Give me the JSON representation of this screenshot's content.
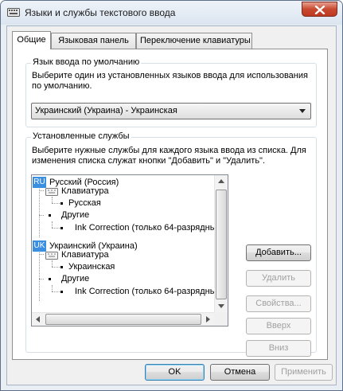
{
  "window": {
    "title": "Языки и службы текстового ввода",
    "close_icon": "close-icon"
  },
  "tabs": [
    {
      "label": "Общие",
      "active": true
    },
    {
      "label": "Языковая панель",
      "active": false
    },
    {
      "label": "Переключение клавиатуры",
      "active": false
    }
  ],
  "default_language": {
    "legend": "Язык ввода по умолчанию",
    "description": [
      "Выберите один из установленных языков ввода для использования",
      "по умолчанию."
    ],
    "selected": "Украинский (Украина) - Украинская"
  },
  "installed_services": {
    "legend": "Установленные службы",
    "description": [
      "Выберите нужные службы для каждого языка ввода из списка. Для",
      "изменения списка служат кнопки \"Добавить\" и \"Удалить\"."
    ],
    "tree": [
      {
        "badge": "RU",
        "label": "Русский (Россия)"
      },
      {
        "label": "Клавиатура"
      },
      {
        "label": "Русская"
      },
      {
        "label": "Другие"
      },
      {
        "label": "Ink Correction (только 64-разрядны"
      },
      {
        "badge": "UK",
        "label": "Украинский (Украина)"
      },
      {
        "label": "Клавиатура"
      },
      {
        "label": "Украинская"
      },
      {
        "label": "Другие"
      },
      {
        "label": "Ink Correction (только 64-разрядны"
      }
    ],
    "buttons": {
      "add": "Добавить...",
      "remove": "Удалить",
      "properties": "Свойства...",
      "up": "Вверх",
      "down": "Вниз"
    }
  },
  "footer": {
    "ok": "OK",
    "cancel": "Отмена",
    "apply": "Применить"
  },
  "colors": {
    "language_badge": "#3a8fe0",
    "close_button": "#c8492f"
  }
}
